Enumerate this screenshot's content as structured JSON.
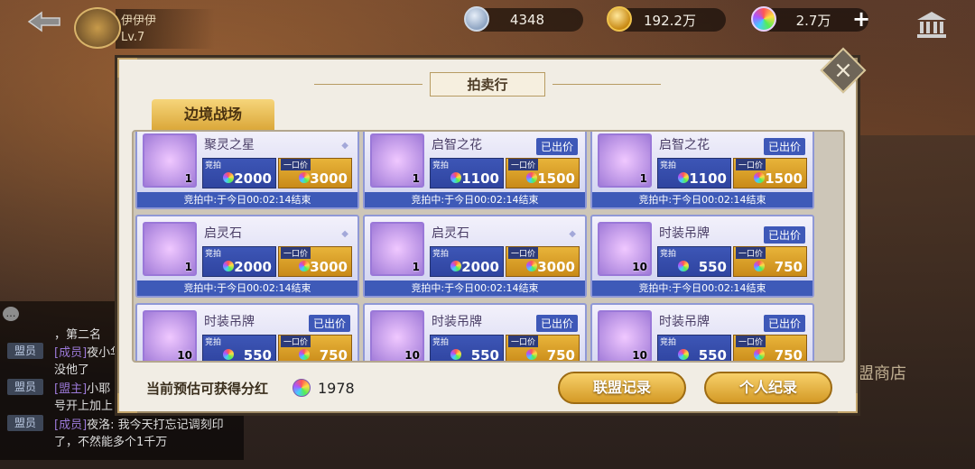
{
  "player": {
    "name": "伊伊伊",
    "level": "Lv.7"
  },
  "currencies": [
    {
      "icon": "silver-coin-icon",
      "value": "4348"
    },
    {
      "icon": "gold-coin-icon",
      "value": "192.2万"
    },
    {
      "icon": "rainbow-gem-icon",
      "value": "2.7万"
    }
  ],
  "dialog": {
    "title": "拍卖行",
    "tab": "边境战场",
    "close_glyph": "×"
  },
  "labels": {
    "bid": "竞拍",
    "buyout": "一口价",
    "sold": "已出价"
  },
  "items": [
    {
      "name": "聚灵之星",
      "count": "1",
      "bid": "2000",
      "buyout": "3000",
      "sold": false,
      "timer": "竞拍中:于今日00:02:14结束"
    },
    {
      "name": "启智之花",
      "count": "1",
      "bid": "1100",
      "buyout": "1500",
      "sold": true,
      "timer": "竞拍中:于今日00:02:14结束"
    },
    {
      "name": "启智之花",
      "count": "1",
      "bid": "1100",
      "buyout": "1500",
      "sold": true,
      "timer": "竞拍中:于今日00:02:14结束"
    },
    {
      "name": "启灵石",
      "count": "1",
      "bid": "2000",
      "buyout": "3000",
      "sold": false,
      "timer": "竞拍中:于今日00:02:14结束"
    },
    {
      "name": "启灵石",
      "count": "1",
      "bid": "2000",
      "buyout": "3000",
      "sold": false,
      "timer": "竞拍中:于今日00:02:14结束"
    },
    {
      "name": "时装吊牌",
      "count": "10",
      "bid": "550",
      "buyout": "750",
      "sold": true,
      "timer": "竞拍中:于今日00:02:14结束"
    },
    {
      "name": "时装吊牌",
      "count": "10",
      "bid": "550",
      "buyout": "750",
      "sold": true,
      "timer": ""
    },
    {
      "name": "时装吊牌",
      "count": "10",
      "bid": "550",
      "buyout": "750",
      "sold": true,
      "timer": ""
    },
    {
      "name": "时装吊牌",
      "count": "10",
      "bid": "550",
      "buyout": "750",
      "sold": true,
      "timer": ""
    }
  ],
  "footer": {
    "label": "当前预估可获得分红",
    "value": "1978",
    "btn_alliance": "联盟记录",
    "btn_personal": "个人纪录"
  },
  "chat": {
    "rank": "，第二名",
    "tag1": "盟员",
    "name1": "[成员]",
    "text1": "夜小华",
    "text1b": "没他了",
    "tag2": "盟员",
    "name2": "[盟主]",
    "text2": "小耶",
    "text2b": "号开上加上",
    "tag3": "盟员",
    "name3": "[成员]",
    "text3": "夜洛: 我今天打忘记调刻印",
    "text3b": "了，不然能多个1千万"
  },
  "bg_text": "盟商店"
}
